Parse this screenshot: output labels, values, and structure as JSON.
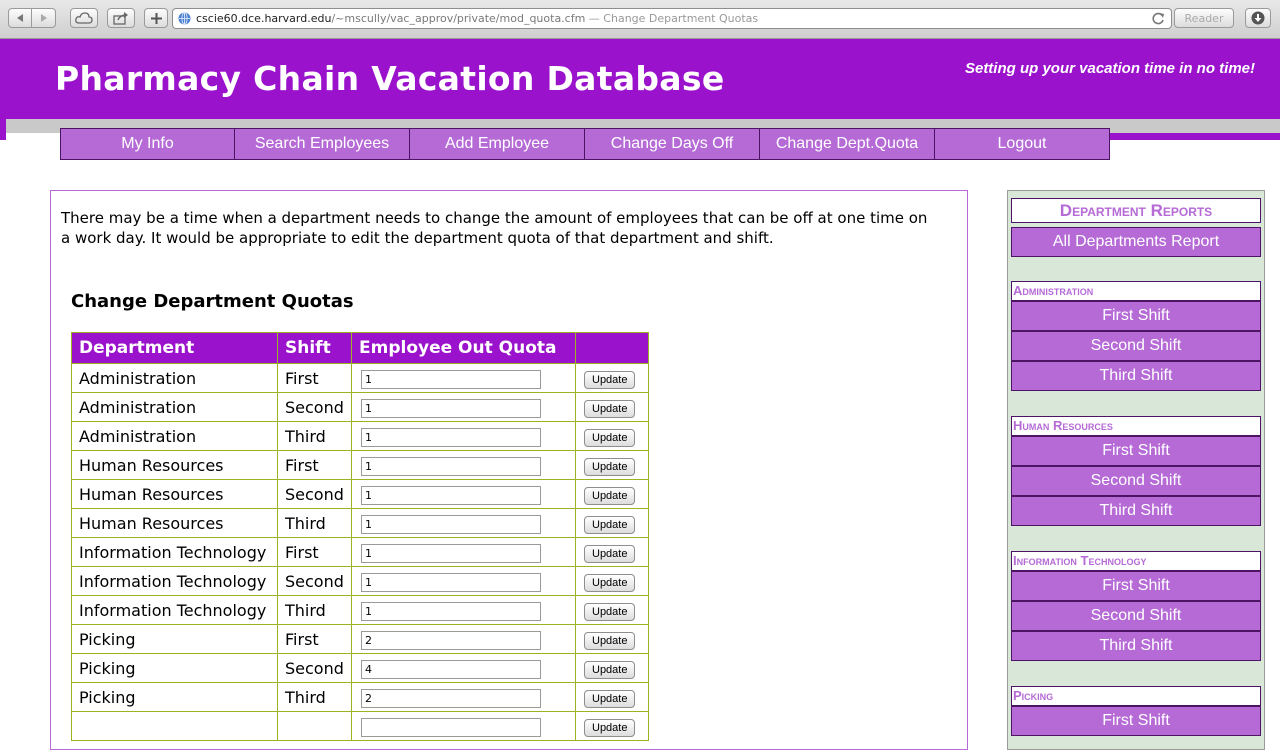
{
  "browser": {
    "url_host": "cscie60.dce.harvard.edu",
    "url_path": "/~mscully/vac_approv/private/mod_quota.cfm",
    "url_title": " — Change Department Quotas",
    "reader_label": "Reader"
  },
  "header": {
    "title": "Pharmacy Chain Vacation Database",
    "tagline": "Setting up your vacation time in no time!"
  },
  "nav": {
    "items": [
      "My Info",
      "Search Employees",
      "Add Employee",
      "Change Days Off",
      "Change Dept.Quota",
      "Logout"
    ]
  },
  "main": {
    "intro": "There may be a time when a department needs to change the amount of employees that can be off at one time on a work day. It would be appropriate to edit the department quota of that department and shift.",
    "section_title": "Change Department Quotas",
    "table": {
      "headers": [
        "Department",
        "Shift",
        "Employee Out Quota",
        ""
      ],
      "button_label": "Update",
      "rows": [
        {
          "department": "Administration",
          "shift": "First",
          "quota": "1"
        },
        {
          "department": "Administration",
          "shift": "Second",
          "quota": "1"
        },
        {
          "department": "Administration",
          "shift": "Third",
          "quota": "1"
        },
        {
          "department": "Human Resources",
          "shift": "First",
          "quota": "1"
        },
        {
          "department": "Human Resources",
          "shift": "Second",
          "quota": "1"
        },
        {
          "department": "Human Resources",
          "shift": "Third",
          "quota": "1"
        },
        {
          "department": "Information Technology",
          "shift": "First",
          "quota": "1"
        },
        {
          "department": "Information Technology",
          "shift": "Second",
          "quota": "1"
        },
        {
          "department": "Information Technology",
          "shift": "Third",
          "quota": "1"
        },
        {
          "department": "Picking",
          "shift": "First",
          "quota": "2"
        },
        {
          "department": "Picking",
          "shift": "Second",
          "quota": "4"
        },
        {
          "department": "Picking",
          "shift": "Third",
          "quota": "2"
        },
        {
          "department": "",
          "shift": "",
          "quota": ""
        }
      ]
    }
  },
  "sidebar": {
    "title": "Department Reports",
    "all_button": "All Departments Report",
    "groups": [
      {
        "name": "Administration",
        "shifts": [
          "First Shift",
          "Second Shift",
          "Third Shift"
        ]
      },
      {
        "name": "Human Resources",
        "shifts": [
          "First Shift",
          "Second Shift",
          "Third Shift"
        ]
      },
      {
        "name": "Information Technology",
        "shifts": [
          "First Shift",
          "Second Shift",
          "Third Shift"
        ]
      },
      {
        "name": "Picking",
        "shifts": [
          "First Shift"
        ]
      }
    ]
  },
  "colors": {
    "brand_purple": "#9b12cc",
    "nav_purple": "#b56ad6",
    "table_border": "#9ab31f",
    "sidebar_bg": "#d8e7d8"
  }
}
